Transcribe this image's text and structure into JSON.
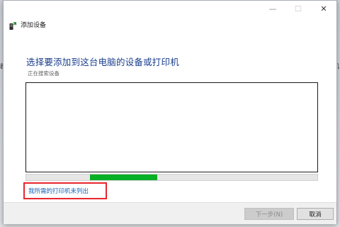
{
  "window": {
    "title": "添加设备",
    "controls": {
      "minimize": "—",
      "maximize": "☐",
      "close": "✕"
    }
  },
  "background": {
    "left_fragment": "器",
    "right_fragment": "机"
  },
  "main": {
    "heading": "选择要添加到这台电脑的设备或打印机",
    "status": "正在搜索设备",
    "progress_fill_start": 0.22,
    "progress_fill_end": 0.45,
    "missing_printer_link": "我所需的打印机未列出"
  },
  "footer": {
    "next_label": "下一步(N)",
    "cancel_label": "取消"
  },
  "colors": {
    "heading": "#1a3e8c",
    "link": "#1a5fb4",
    "progress": "#06b025",
    "highlight_box": "#e8262d"
  }
}
